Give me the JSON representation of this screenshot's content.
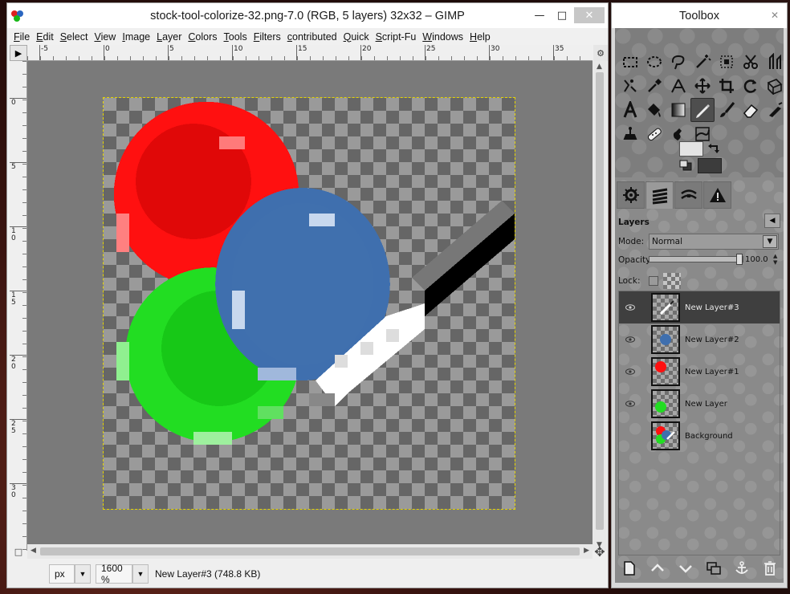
{
  "main_window": {
    "title": "stock-tool-colorize-32.png-7.0 (RGB, 5 layers) 32x32 – GIMP",
    "minimize": "—",
    "maximize": "□",
    "close": "✕"
  },
  "menu": [
    "File",
    "Edit",
    "Select",
    "View",
    "Image",
    "Layer",
    "Colors",
    "Tools",
    "Filters",
    "contributed",
    "Quick",
    "Script-Fu",
    "Windows",
    "Help"
  ],
  "rulers": {
    "horizontal_labels": [
      "-5",
      "0",
      "5",
      "10",
      "15",
      "20",
      "25",
      "30",
      "35"
    ],
    "vertical_labels": [
      "0",
      "5",
      "10",
      "15",
      "20",
      "25",
      "30"
    ]
  },
  "status": {
    "unit": "px",
    "zoom": "1600 %",
    "message": "New Layer#3 (748.8 KB)"
  },
  "toolbox": {
    "title": "Toolbox",
    "close": "✕",
    "tools": [
      "rect-select-icon",
      "ellipse-select-icon",
      "free-select-icon",
      "fuzzy-select-icon",
      "by-color-select-icon",
      "scissors-icon",
      "foreground-select-icon",
      "paths-icon",
      "color-picker-icon",
      "measure-icon",
      "move-icon",
      "crop-icon",
      "rotate-icon",
      "perspective-icon",
      "text-icon",
      "bucket-fill-icon",
      "blend-icon",
      "pencil-icon",
      "paintbrush-icon",
      "eraser-icon",
      "airbrush-icon",
      "clone-icon",
      "heal-icon",
      "smudge-icon",
      "warp-icon"
    ],
    "active_tool": "pencil-icon",
    "fg_color": "#e3e3e3",
    "bg_color": "#3c3c3c"
  },
  "layers_dock": {
    "tabs": [
      "tool-options-icon",
      "layers-icon",
      "paths-icon",
      "undo-warning-icon"
    ],
    "header": "Layers",
    "mode_label": "Mode:",
    "mode_value": "Normal",
    "opacity_label": "Opacity:",
    "opacity_value": "100.0",
    "opacity_fraction": 1.0,
    "lock_label": "Lock:",
    "layers": [
      {
        "name": "New Layer#3",
        "visible": true,
        "selected": true,
        "thumb": "brush"
      },
      {
        "name": "New Layer#2",
        "visible": true,
        "selected": false,
        "thumb": "blue"
      },
      {
        "name": "New Layer#1",
        "visible": true,
        "selected": false,
        "thumb": "red"
      },
      {
        "name": "New Layer",
        "visible": true,
        "selected": false,
        "thumb": "green"
      },
      {
        "name": "Background",
        "visible": false,
        "selected": false,
        "thumb": "composite"
      }
    ],
    "buttons": [
      "new-layer-icon",
      "raise-layer-icon",
      "lower-layer-icon",
      "duplicate-layer-icon",
      "anchor-layer-icon",
      "delete-layer-icon"
    ]
  }
}
